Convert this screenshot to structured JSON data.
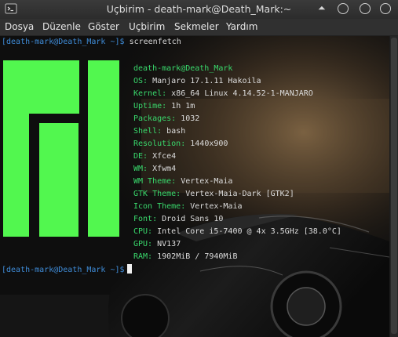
{
  "window": {
    "title": "Uçbirim - death-mark@Death_Mark:~"
  },
  "menubar": {
    "items": [
      "Dosya",
      "Düzenle",
      "Göster",
      "Uçbirim",
      "Sekmeler",
      "Yardım"
    ]
  },
  "terminal": {
    "prompt1": "[death-mark@Death_Mark ~]$",
    "command1": " screenfetch",
    "prompt2": "[death-mark@Death_Mark ~]$",
    "header": "death-mark@Death_Mark",
    "info": [
      {
        "key": "OS:",
        "value": " Manjaro 17.1.11 Hakoila"
      },
      {
        "key": "Kernel:",
        "value": " x86_64 Linux 4.14.52-1-MANJARO"
      },
      {
        "key": "Uptime:",
        "value": " 1h 1m"
      },
      {
        "key": "Packages:",
        "value": " 1032"
      },
      {
        "key": "Shell:",
        "value": " bash"
      },
      {
        "key": "Resolution:",
        "value": " 1440x900"
      },
      {
        "key": "DE:",
        "value": " Xfce4"
      },
      {
        "key": "WM:",
        "value": " Xfwm4"
      },
      {
        "key": "WM Theme:",
        "value": " Vertex-Maia"
      },
      {
        "key": "GTK Theme:",
        "value": " Vertex-Maia-Dark [GTK2]"
      },
      {
        "key": "Icon Theme:",
        "value": " Vertex-Maia"
      },
      {
        "key": "Font:",
        "value": " Droid Sans 10"
      },
      {
        "key": "CPU:",
        "value": " Intel Core i5-7400 @ 4x 3.5GHz [38.0°C]"
      },
      {
        "key": "GPU:",
        "value": " NV137"
      },
      {
        "key": "RAM:",
        "value": " 1902MiB / 7940MiB"
      }
    ]
  },
  "colors": {
    "logo": "#52f74f",
    "prompt": "#3f8cd8",
    "info_key": "#39d96c"
  },
  "icons": {
    "app": "terminal-icon",
    "menu": "window-menu-arrow-icon",
    "minimize": "minimize-icon",
    "maximize": "maximize-icon",
    "close": "close-icon"
  }
}
